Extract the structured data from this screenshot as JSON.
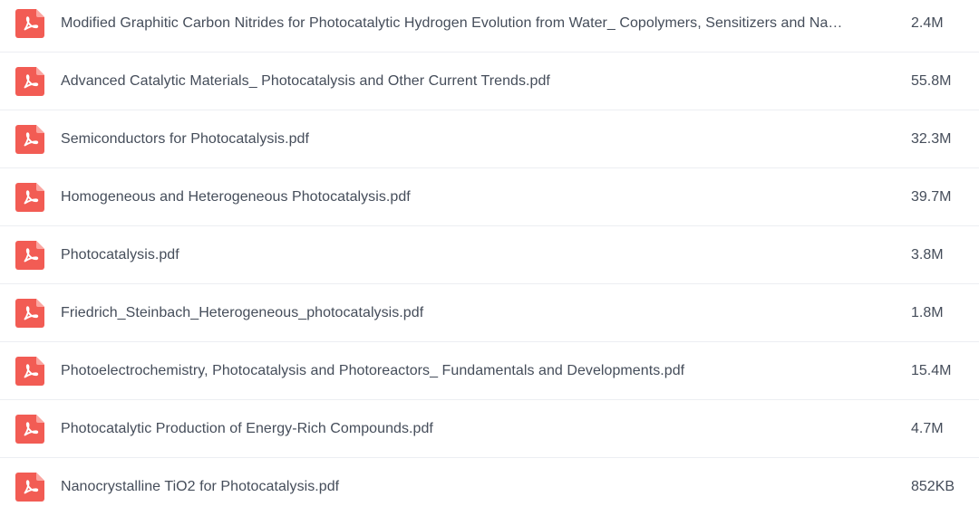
{
  "files": [
    {
      "name": "Modified Graphitic Carbon Nitrides for Photocatalytic Hydrogen Evolution from Water_ Copolymers, Sensitizers and Na…",
      "size": "2.4M",
      "icon": "pdf-icon"
    },
    {
      "name": "Advanced Catalytic Materials_ Photocatalysis and Other Current Trends.pdf",
      "size": "55.8M",
      "icon": "pdf-icon"
    },
    {
      "name": "Semiconductors for Photocatalysis.pdf",
      "size": "32.3M",
      "icon": "pdf-icon"
    },
    {
      "name": "Homogeneous and Heterogeneous Photocatalysis.pdf",
      "size": "39.7M",
      "icon": "pdf-icon"
    },
    {
      "name": "Photocatalysis.pdf",
      "size": "3.8M",
      "icon": "pdf-icon"
    },
    {
      "name": "Friedrich_Steinbach_Heterogeneous_photocatalysis.pdf",
      "size": "1.8M",
      "icon": "pdf-icon"
    },
    {
      "name": "Photoelectrochemistry, Photocatalysis and Photoreactors_ Fundamentals and Developments.pdf",
      "size": "15.4M",
      "icon": "pdf-icon"
    },
    {
      "name": "Photocatalytic Production of Energy-Rich Compounds.pdf",
      "size": "4.7M",
      "icon": "pdf-icon"
    },
    {
      "name": "Nanocrystalline TiO2 for Photocatalysis.pdf",
      "size": "852KB",
      "icon": "pdf-icon"
    }
  ],
  "colors": {
    "pdf_icon": "#f25c54",
    "text": "#454d5a",
    "divider": "#eceef2"
  }
}
